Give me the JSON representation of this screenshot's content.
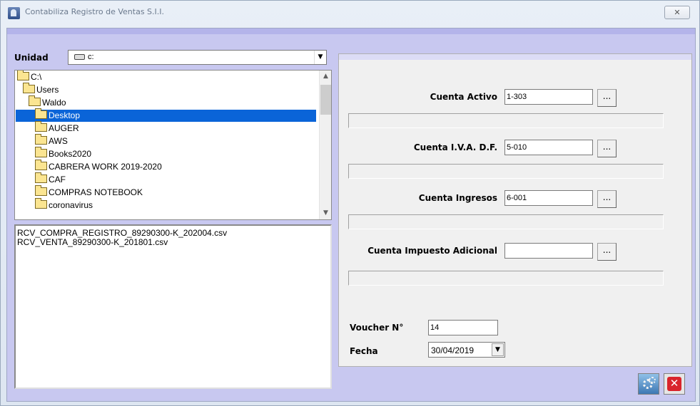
{
  "window": {
    "title": "Contabiliza Registro de Ventas S.I.I.",
    "close_glyph": "✕"
  },
  "drive": {
    "label": "Unidad",
    "selected": "c:"
  },
  "directory_tree": {
    "items": [
      {
        "label": "C:\\",
        "state": "open"
      },
      {
        "label": "Users",
        "state": "open"
      },
      {
        "label": "Waldo",
        "state": "open"
      },
      {
        "label": "Desktop",
        "state": "open",
        "selected": true
      },
      {
        "label": "AUGER"
      },
      {
        "label": "AWS"
      },
      {
        "label": "Books2020"
      },
      {
        "label": "CABRERA WORK 2019-2020"
      },
      {
        "label": "CAF"
      },
      {
        "label": "COMPRAS NOTEBOOK"
      },
      {
        "label": "coronavirus"
      }
    ]
  },
  "file_list": {
    "files": [
      "RCV_COMPRA_REGISTRO_89290300-K_202004.csv",
      "RCV_VENTA_89290300-K_201801.csv"
    ]
  },
  "accounts": {
    "activo": {
      "label": "Cuenta Activo",
      "value": "1-303",
      "description": ""
    },
    "iva": {
      "label": "Cuenta I.V.A. D.F.",
      "value": "5-010",
      "description": ""
    },
    "ingresos": {
      "label": "Cuenta Ingresos",
      "value": "6-001",
      "description": ""
    },
    "impuesto": {
      "label": "Cuenta Impuesto Adicional",
      "value": "",
      "description": ""
    },
    "browse_label": "..."
  },
  "voucher": {
    "label": "Voucher N°",
    "value": "14"
  },
  "fecha": {
    "label": "Fecha",
    "value": "30/04/2019"
  },
  "buttons": {
    "exit_glyph": "✕"
  },
  "icons": {
    "app": "app-icon",
    "drive": "hard-drive-icon",
    "folder": "folder-icon",
    "settings": "gears-icon",
    "exit": "close-icon"
  }
}
